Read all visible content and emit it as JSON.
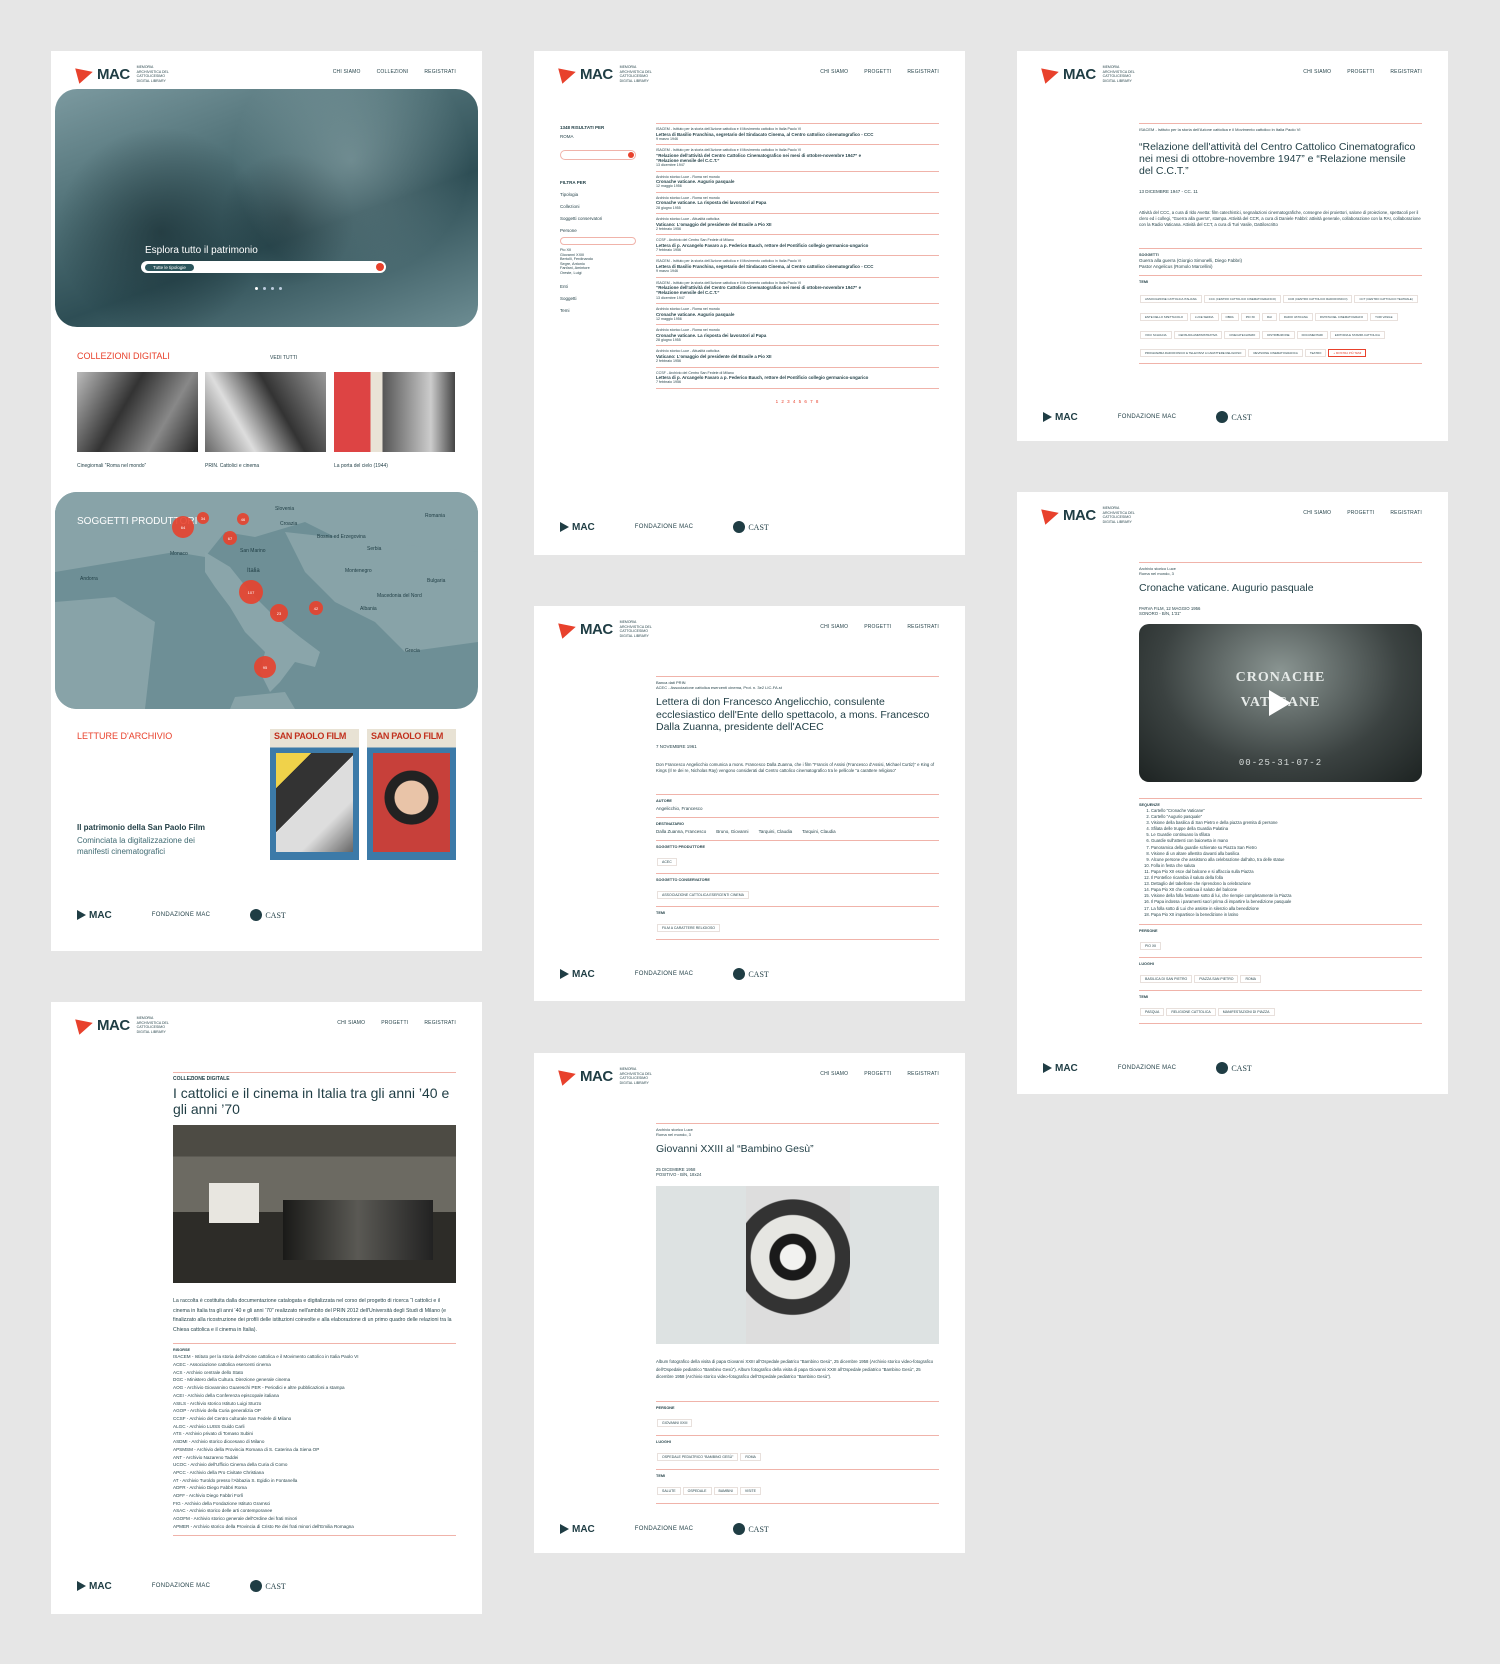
{
  "brand": {
    "name": "MAC",
    "tagline": "MEMORIA ARCHIVISTICA DEL CATTOLICESIMO DIGITAL LIBRARY"
  },
  "nav": {
    "home": [
      "CHI SIAMO",
      "COLLEZIONI",
      "REGISTRATI"
    ],
    "other": [
      "CHI SIAMO",
      "PROGETTI",
      "REGISTRATI"
    ]
  },
  "footer": {
    "mac": "MAC",
    "fondazione": "FONDAZIONE MAC",
    "cast": "CAST"
  },
  "home": {
    "hero_text": "Esplora tutto il patrimonio",
    "search_placeholder": "Tutte le tipologie",
    "collections_title": "COLLEZIONI DIGITALI",
    "see_all": "VEDI TUTTI",
    "collections": [
      "Cinegiornali “Roma nel mondo”",
      "PRIN. Cattolici e cinema",
      "La porta del cielo (1944)"
    ],
    "map_title": "SOGGETTI PRODUTTORI",
    "map_labels": [
      "Slovenia",
      "Croazia",
      "Bosnia ed Erzegovina",
      "Serbia",
      "Romania",
      "Monaco",
      "San Marino",
      "Montenegro",
      "Bulgaria",
      "Andorra",
      "Italia",
      "Macedonia del Nord",
      "Albania",
      "Grecia"
    ],
    "map_markers": [
      "64",
      "34",
      "46",
      "67",
      "107",
      "23",
      "42",
      "95"
    ],
    "letture_title": "LETTURE D'ARCHIVIO",
    "letture_heading": "Il patrimonio della San Paolo Film",
    "letture_text": "Cominciata la digitalizzazione dei manifesti cinematografici",
    "poster_title": "SAN PAOLO FILM"
  },
  "results": {
    "count": "1348 RISULTATI PER",
    "filter_value": "ROMA",
    "filter_label": "FILTRA PER",
    "filters": [
      "Tipologia",
      "Collezioni",
      "Soggetti conservatori",
      "Persone"
    ],
    "filters_more": [
      "Enti",
      "Soggetti",
      "Temi"
    ],
    "persons": [
      "Pio XII",
      "Giovanni XXIII",
      "Bertolli, Ferdinando",
      "Segre, Antonio",
      "Fanfani, Amintore",
      "Oreste, Luigi"
    ],
    "items": [
      {
        "src": "ISACEM - Istituto per la storia dell'Azione cattolica e il Movimento cattolico in Italia Paolo VI",
        "title": "Lettera di Basilio Franchina, segretario del Sindacato Cinema, al Centro cattolico cinematografico - CCC",
        "date": "9 marzo 1946"
      },
      {
        "src": "ISACEM - Istituto per la storia dell'Azione cattolica e il Movimento cattolico in Italia Paolo VI",
        "title": "“Relazione dell'attività del Centro Cattolico Cinematografico nei mesi di ottobre-novembre 1947” e “Relazione mensile del C.C.T.”",
        "date": "13 dicembre 1947"
      },
      {
        "src": "Archivio storico Luce - Roma nel mondo",
        "title": "Cronache vaticane. Augurio pasquale",
        "date": "12 maggio 1956"
      },
      {
        "src": "Archivio storico Luce - Roma nel mondo",
        "title": "Cronache vaticane. La risposta dei lavoratori al Papa",
        "date": "28 giugno 1955"
      },
      {
        "src": "Archivio storico Luce - Attualità cattolica",
        "title": "Vaticano: L'omaggio del presidente del Brasile a Pio XII",
        "date": "2 febbraio 1956"
      },
      {
        "src": "CCSF - Archivio del Centro San Fedele di Milano",
        "title": "Lettera di p. Arcangelo Favaro a p. Federico Bauch, rettore del Pontificio collegio germanico-ungarico",
        "date": "7 febbraio 1956"
      },
      {
        "src": "ISACEM - Istituto per la storia dell'Azione cattolica e il Movimento cattolico in Italia Paolo VI",
        "title": "Lettera di Basilio Franchina, segretario del Sindacato Cinema, al Centro cattolico cinematografico - CCC",
        "date": "9 marzo 1946"
      },
      {
        "src": "ISACEM - Istituto per la storia dell'Azione cattolica e il Movimento cattolico in Italia Paolo VI",
        "title": "“Relazione dell'attività del Centro Cattolico Cinematografico nei mesi di ottobre-novembre 1947” e “Relazione mensile del C.C.T.”",
        "date": "13 dicembre 1947"
      },
      {
        "src": "Archivio storico Luce - Roma nel mondo",
        "title": "Cronache vaticane. Augurio pasquale",
        "date": "12 maggio 1956"
      },
      {
        "src": "Archivio storico Luce - Roma nel mondo",
        "title": "Cronache vaticane. La risposta dei lavoratori al Papa",
        "date": "28 giugno 1955"
      },
      {
        "src": "Archivio storico Luce - Attualità cattolica",
        "title": "Vaticano: L'omaggio del presidente del Brasile a Pio XII",
        "date": "2 febbraio 1956"
      },
      {
        "src": "CCSF - Archivio del Centro San Fedele di Milano",
        "title": "Lettera di p. Arcangelo Favaro a p. Federico Bauch, rettore del Pontificio collegio germanico-ungarico",
        "date": "7 febbraio 1956"
      }
    ],
    "pages": "1 2 3 4 5 6 7 8"
  },
  "relazione": {
    "src": "ISACEM - Istituto per la storia dell'Azione cattolica e il Movimento cattolico in Italia Paolo VI",
    "title": "“Relazione dell'attività del Centro Cattolico Cinematografico nei mesi di ottobre-novembre 1947” e “Relazione mensile del C.C.T.”",
    "date": "13 DICEMBRE 1947 - CC. 11",
    "body": "Attività del CCC, a cura di Ildo Avetta: film catechistici, segnalazioni cinematografiche, consegne dei proiettori, salone di proiezione, spettacoli per il clero ed i collegi, “Guerra alla guerra”, stampa. Attività del CCR, a cura di Daniele Fabbri: attività generale, collaborazione con la RAI, collaborazione con la Radio Vaticana. Attività del CCT, a cura di Turi Vasile, Dattiloscritto",
    "soggetti_label": "SOGGETTI",
    "soggetti": [
      "Guerra alla guerra (Giorgio Simonelli, Diego Fabbri)",
      "Pastor Angelicus (Romolo Marcellini)"
    ],
    "temi_label": "TEMI",
    "temi": [
      "ASSOCIAZIONE CATTOLICA ITALIANA",
      "CCC (CENTRO CATTOLICO CINEMATOGRAFICO)",
      "CCR (CENTRO CATTOLICO RADIOFONICO)",
      "CCT (CENTRO CATTOLICO TEATRALE)",
      "ENTE DELLO SPETTACOLO",
      "LUCE SEDDA",
      "OBRA",
      "PIO XII",
      "RAI",
      "RADIO VATICANA",
      "RIVISTA DEL CINEMATOGRAFO",
      "TURI VASILE",
      "VOCI SCHIACIA",
      "CENSURA AMMINISTRATIVA",
      "CINECATECHISMO",
      "DISTRIBUZIONE",
      "DOCUMENTARI",
      "EDITORIA E STAMPA CATTOLICA",
      "PROGRAMMA RADIOFONICO E TELEVISIVI A CARATTERE RELIGIOSO",
      "REVISIONE CINEMATOGRAFICA",
      "TEATRO",
      "+ MOSTRA PIÙ TEMI"
    ]
  },
  "lettera": {
    "src": "Banca dati PRIN",
    "src2": "ACEC - Associazione cattolica esercenti cinema, Prot. n. 3e2 LIC-FA.st",
    "title": "Lettera di don Francesco Angelicchio, consulente ecclesiastico dell'Ente dello spettacolo, a mons. Francesco Dalla Zuanna, presidente dell'ACEC",
    "date": "7 NOVEMBRE 1961",
    "body": "Don Francesco Angelicchio comunica a mons. Francesco Dalla Zuanna, che i film “Francis of Assisi (Francesco d'Assisi, Michael Curtiz)” e King of Kings (Il re dei re, Nicholas Ray) vengono considerati dal Centro cattolico cinematografico tra le pellicole “a carattere religioso”",
    "autore_label": "AUTORE",
    "autore": "Angelicchio, Francesco",
    "dest_label": "DESTINATARIO",
    "dest": [
      "Dalla Zuanna, Francesco",
      "Bruno, Giovanni",
      "Tarquini, Claudia",
      "Tarquini, Claudia"
    ],
    "prod_label": "SOGGETTO PRODUTTORE",
    "prod": "ACEC",
    "cons_label": "SOGGETTO CONSERVATORE",
    "cons": "ASSOCIAZIONE CATTOLICA ESERCENTI CINEMA",
    "temi_label": "TEMI",
    "temi": "FILM A CARATTERE RELIGIOSO"
  },
  "cronache": {
    "src": "Archivio storico Luce",
    "src2": "Roma nel mondo, 3",
    "title": "Cronache vaticane. Augurio pasquale",
    "meta1": "PARVA FILM, 12 MAGGIO 1956",
    "meta2": "SONORO - B/N, 1'31\"",
    "video_line1": "CRONACHE",
    "video_line2": "VATICANE",
    "timecode": "00-25-31-07-2",
    "seq_label": "SEQUENZE",
    "sequenze": [
      "Cartello “Cronache Vaticane”",
      "Cartello “Augurio pasquale”",
      "Visione della basilica di San Pietro e della piazza gremita di persone",
      "Sfilata delle truppe della Guardia Palatina",
      "Le Guardie continuano la sfilata",
      "Guardie sull'attenti con baionetta in mano",
      "Panoramica della guardie schierate su Piazza San Pietro",
      "Visione di un altare allestito davanti alla basilica",
      "Alcune persone che assistono alla celebrazione dall'alto, tra delle statue",
      "Folla in festa che saluta",
      "Papa Pio XII esce dal balcone e si affaccia sulla Piazza",
      "Il Pontefice ricambia il saluto della folla",
      "Dettaglio del tabellone che riprendono la celebrazione",
      "Papa Pio XII che continua il saluto del balcone",
      "Visione della folla festante sotto di lui, che riempie completamente la Piazza",
      "Il Papa indossa i paramenti sacri prima di impartire la benedizione pasquale",
      "La folla sotto di Lui che assiste in silenzio alla benedizione",
      "Papa Pio XII impartisce la benedizione in latino"
    ],
    "persone_label": "PERSONE",
    "persone": "PIO XII",
    "luoghi_label": "LUOGHI",
    "luoghi": [
      "BASILICA DI SAN PIETRO",
      "PIAZZA SAN PIETRO",
      "ROMA"
    ],
    "temi_label": "TEMI",
    "temi": [
      "PASQUA",
      "RELIGIONE CATTOLICA",
      "MANIFESTAZIONI DI PIAZZA"
    ]
  },
  "collezione": {
    "label": "COLLEZIONE DIGITALE",
    "title": "I cattolici e il cinema in Italia tra gli anni ’40 e gli anni ’70",
    "body": "La raccolta è costituita dalla documentazione catalogata e digitalizzata nel corso del progetto di ricerca “I cattolici e il cinema in Italia tra gli anni ‘40 e gli anni ‘70” realizzato nell'ambito del PRIN 2012 dell'Università degli Studi di Milano (e finalizzato alla ricostruzione dei profili delle istituzioni coinvolte e alla elaborazione di un primo quadro delle relazioni tra la Chiesa cattolica e il cinema in Italia).",
    "risorse_label": "RISORSE",
    "risorse": [
      "ISACEM - Istituto per la storia dell'Azione cattolica e il Movimento cattolico in Italia Paolo VI",
      "ACEC - Associazione cattolica esercenti cinema",
      "ACS - Archivio centrale dello Stato",
      "DGC - Ministero della Cultura. Direzione generale cinema",
      "AOG - Archivio Giovannino Guareschi PER - Periodici e altre pubblicazioni a stampa",
      "ACEI - Archivio della Conferenza episcopale italiana",
      "ASILS - Archivio storico Istituto Luigi Sturzo",
      "AGOP - Archivio della Curia generalizia OP",
      "CCSF - Archivio del Centro culturale San Fedele di Milano",
      "ALGC - Archivio LUISS Guido Carli",
      "ATS - Archivio privato di Tomaso Subini",
      "ASDMI - Archivio storico diocesano di Milano",
      "APSMSM - Archivio della Provincia Romana di S. Caterina da Siena OP",
      "ANT - Archivio Nazareno Taddei",
      "UCOC - Archivio dell'Ufficio Cinema della Curia di Como",
      "APCC - Archivio della Pro Civitate Christiana",
      "AT - Archivio Turoldo presso l'Abbazia S. Egidio in Fontanella",
      "ADFR - Archivio Diego Fabbri Roma",
      "ADFF - Archivio Diego Fabbri Forlì",
      "FIG - Archivio della Fondazione Istituto Gramsci",
      "ASAC - Archivio storico delle arti contemporanee",
      "AGOFM - Archivio storico generale dell'Ordine dei frati minori",
      "APMER - Archivio storico della Provincia di Cristo Re dei frati minori dell'Emilia Romagna"
    ]
  },
  "giovanni": {
    "src": "Archivio storico Luce",
    "src2": "Roma nel mondo, 3",
    "title": "Giovanni XXIII al “Bambino Gesù”",
    "meta1": "25 DICEMBRE 1958",
    "meta2": "POSITIVO - B/N, 18x24",
    "body": "Album fotografico della visita di papa Giovanni XXIII all'Ospedale pediatrico “Bambino Gesù”, 25 dicembre 1958 (Archivio storico video-fotografico dell'Ospedale pediatrico “Bambino Gesù”). Album fotografico della visita di papa Giovanni XXIII all'Ospedale pediatrico “Bambino Gesù”, 25 dicembre 1958 (Archivio storico video-fotografico dell'Ospedale pediatrico “Bambino Gesù”).",
    "persone_label": "PERSONE",
    "persone": "GIOVANNI XXIII",
    "luoghi_label": "LUOGHI",
    "luoghi": [
      "OSPEDALE PEDIATRICO “BAMBINO GESÙ”",
      "ROMA"
    ],
    "temi_label": "TEMI",
    "temi": [
      "SALUTE",
      "OSPEDALE",
      "BAMBINI",
      "VISITE"
    ]
  },
  "colors": {
    "accent": "#e8412c",
    "teal": "#1f3d44",
    "bg": "#e6e6e6"
  }
}
